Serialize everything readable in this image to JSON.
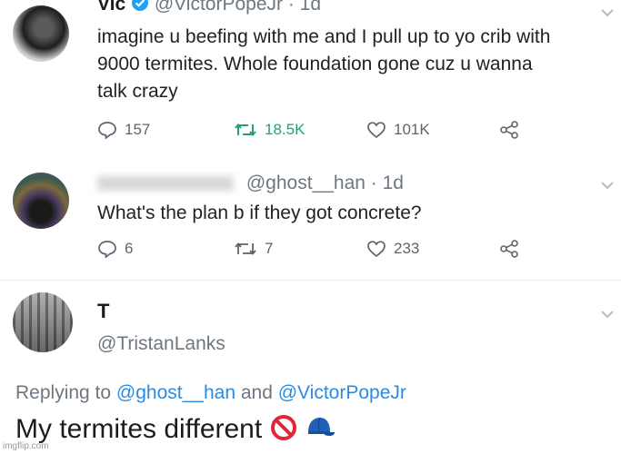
{
  "tweets": [
    {
      "name": "Vic",
      "handle": "@VictorPopeJr",
      "time": "· 1d",
      "text_lines": [
        "imagine u beefing with me and I pull up to yo crib with",
        "9000 termites. Whole foundation gone cuz u wanna",
        "talk crazy"
      ],
      "replies": "157",
      "retweets": "18.5K",
      "likes": "101K"
    },
    {
      "handle": "@ghost__han",
      "time": "· 1d",
      "text": "What's the plan b if they got concrete?",
      "replies": "6",
      "retweets": "7",
      "likes": "233"
    }
  ],
  "reply": {
    "name": "T",
    "handle": "@TristanLanks",
    "replying_prefix": "Replying to",
    "replying_to_1": "@ghost__han",
    "replying_and": "and",
    "replying_to_2": "@VictorPopeJr",
    "text": "My termites different"
  },
  "watermark": "imgflip.com",
  "colors": {
    "accent": "#2c8bdc",
    "retweet": "#23a36b",
    "muted": "#6e7781"
  }
}
